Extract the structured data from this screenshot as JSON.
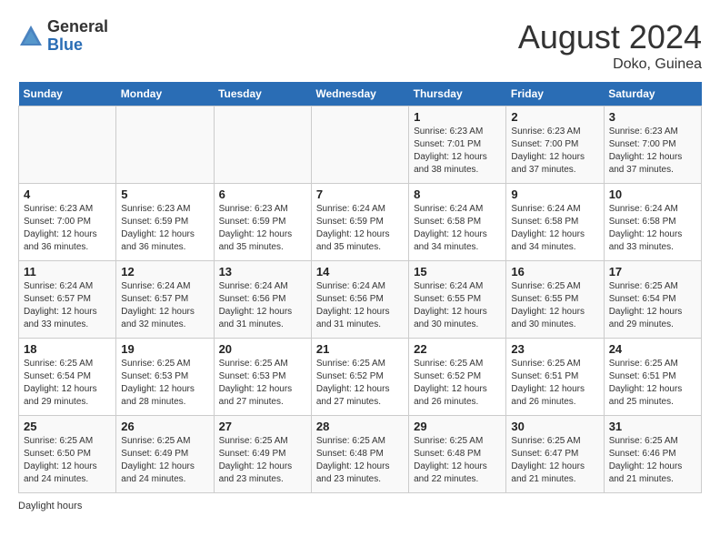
{
  "header": {
    "logo_general": "General",
    "logo_blue": "Blue",
    "month_year": "August 2024",
    "location": "Doko, Guinea"
  },
  "days_of_week": [
    "Sunday",
    "Monday",
    "Tuesday",
    "Wednesday",
    "Thursday",
    "Friday",
    "Saturday"
  ],
  "weeks": [
    [
      {
        "day": "",
        "info": ""
      },
      {
        "day": "",
        "info": ""
      },
      {
        "day": "",
        "info": ""
      },
      {
        "day": "",
        "info": ""
      },
      {
        "day": "1",
        "info": "Sunrise: 6:23 AM\nSunset: 7:01 PM\nDaylight: 12 hours\nand 38 minutes."
      },
      {
        "day": "2",
        "info": "Sunrise: 6:23 AM\nSunset: 7:00 PM\nDaylight: 12 hours\nand 37 minutes."
      },
      {
        "day": "3",
        "info": "Sunrise: 6:23 AM\nSunset: 7:00 PM\nDaylight: 12 hours\nand 37 minutes."
      }
    ],
    [
      {
        "day": "4",
        "info": "Sunrise: 6:23 AM\nSunset: 7:00 PM\nDaylight: 12 hours\nand 36 minutes."
      },
      {
        "day": "5",
        "info": "Sunrise: 6:23 AM\nSunset: 6:59 PM\nDaylight: 12 hours\nand 36 minutes."
      },
      {
        "day": "6",
        "info": "Sunrise: 6:23 AM\nSunset: 6:59 PM\nDaylight: 12 hours\nand 35 minutes."
      },
      {
        "day": "7",
        "info": "Sunrise: 6:24 AM\nSunset: 6:59 PM\nDaylight: 12 hours\nand 35 minutes."
      },
      {
        "day": "8",
        "info": "Sunrise: 6:24 AM\nSunset: 6:58 PM\nDaylight: 12 hours\nand 34 minutes."
      },
      {
        "day": "9",
        "info": "Sunrise: 6:24 AM\nSunset: 6:58 PM\nDaylight: 12 hours\nand 34 minutes."
      },
      {
        "day": "10",
        "info": "Sunrise: 6:24 AM\nSunset: 6:58 PM\nDaylight: 12 hours\nand 33 minutes."
      }
    ],
    [
      {
        "day": "11",
        "info": "Sunrise: 6:24 AM\nSunset: 6:57 PM\nDaylight: 12 hours\nand 33 minutes."
      },
      {
        "day": "12",
        "info": "Sunrise: 6:24 AM\nSunset: 6:57 PM\nDaylight: 12 hours\nand 32 minutes."
      },
      {
        "day": "13",
        "info": "Sunrise: 6:24 AM\nSunset: 6:56 PM\nDaylight: 12 hours\nand 31 minutes."
      },
      {
        "day": "14",
        "info": "Sunrise: 6:24 AM\nSunset: 6:56 PM\nDaylight: 12 hours\nand 31 minutes."
      },
      {
        "day": "15",
        "info": "Sunrise: 6:24 AM\nSunset: 6:55 PM\nDaylight: 12 hours\nand 30 minutes."
      },
      {
        "day": "16",
        "info": "Sunrise: 6:25 AM\nSunset: 6:55 PM\nDaylight: 12 hours\nand 30 minutes."
      },
      {
        "day": "17",
        "info": "Sunrise: 6:25 AM\nSunset: 6:54 PM\nDaylight: 12 hours\nand 29 minutes."
      }
    ],
    [
      {
        "day": "18",
        "info": "Sunrise: 6:25 AM\nSunset: 6:54 PM\nDaylight: 12 hours\nand 29 minutes."
      },
      {
        "day": "19",
        "info": "Sunrise: 6:25 AM\nSunset: 6:53 PM\nDaylight: 12 hours\nand 28 minutes."
      },
      {
        "day": "20",
        "info": "Sunrise: 6:25 AM\nSunset: 6:53 PM\nDaylight: 12 hours\nand 27 minutes."
      },
      {
        "day": "21",
        "info": "Sunrise: 6:25 AM\nSunset: 6:52 PM\nDaylight: 12 hours\nand 27 minutes."
      },
      {
        "day": "22",
        "info": "Sunrise: 6:25 AM\nSunset: 6:52 PM\nDaylight: 12 hours\nand 26 minutes."
      },
      {
        "day": "23",
        "info": "Sunrise: 6:25 AM\nSunset: 6:51 PM\nDaylight: 12 hours\nand 26 minutes."
      },
      {
        "day": "24",
        "info": "Sunrise: 6:25 AM\nSunset: 6:51 PM\nDaylight: 12 hours\nand 25 minutes."
      }
    ],
    [
      {
        "day": "25",
        "info": "Sunrise: 6:25 AM\nSunset: 6:50 PM\nDaylight: 12 hours\nand 24 minutes."
      },
      {
        "day": "26",
        "info": "Sunrise: 6:25 AM\nSunset: 6:49 PM\nDaylight: 12 hours\nand 24 minutes."
      },
      {
        "day": "27",
        "info": "Sunrise: 6:25 AM\nSunset: 6:49 PM\nDaylight: 12 hours\nand 23 minutes."
      },
      {
        "day": "28",
        "info": "Sunrise: 6:25 AM\nSunset: 6:48 PM\nDaylight: 12 hours\nand 23 minutes."
      },
      {
        "day": "29",
        "info": "Sunrise: 6:25 AM\nSunset: 6:48 PM\nDaylight: 12 hours\nand 22 minutes."
      },
      {
        "day": "30",
        "info": "Sunrise: 6:25 AM\nSunset: 6:47 PM\nDaylight: 12 hours\nand 21 minutes."
      },
      {
        "day": "31",
        "info": "Sunrise: 6:25 AM\nSunset: 6:46 PM\nDaylight: 12 hours\nand 21 minutes."
      }
    ]
  ],
  "footer": {
    "note": "Daylight hours"
  }
}
